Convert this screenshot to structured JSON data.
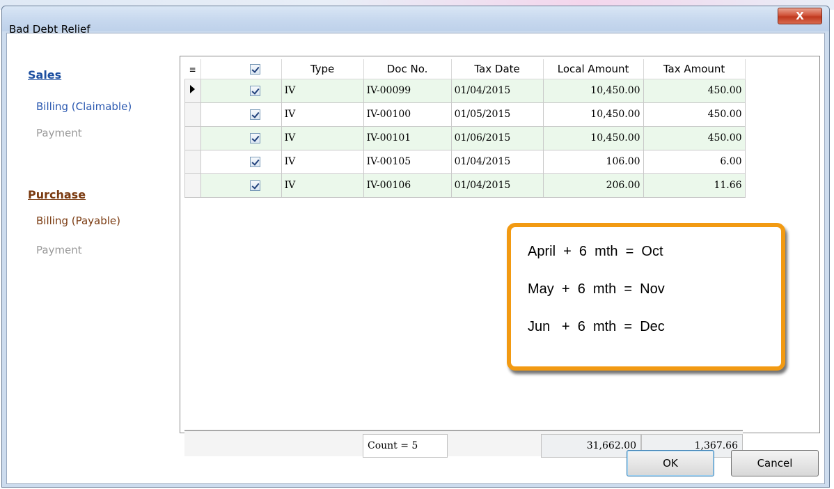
{
  "window": {
    "title": "Bad Debt Relief",
    "close_label": "X"
  },
  "sidebar": {
    "sales_heading": "Sales",
    "sales_items": [
      "Billing (Claimable)",
      "Payment"
    ],
    "purchase_heading": "Purchase",
    "purchase_items": [
      "Billing (Payable)",
      "Payment"
    ]
  },
  "grid": {
    "columns": [
      "Type",
      "Doc No.",
      "Tax Date",
      "Local Amount",
      "Tax Amount"
    ],
    "rows": [
      {
        "type": "IV",
        "doc_no": "IV-00099",
        "tax_date": "01/04/2015",
        "local_amount": "10,450.00",
        "tax_amount": "450.00"
      },
      {
        "type": "IV",
        "doc_no": "IV-00100",
        "tax_date": "01/05/2015",
        "local_amount": "10,450.00",
        "tax_amount": "450.00"
      },
      {
        "type": "IV",
        "doc_no": "IV-00101",
        "tax_date": "01/06/2015",
        "local_amount": "10,450.00",
        "tax_amount": "450.00"
      },
      {
        "type": "IV",
        "doc_no": "IV-00105",
        "tax_date": "01/04/2015",
        "local_amount": "106.00",
        "tax_amount": "6.00"
      },
      {
        "type": "IV",
        "doc_no": "IV-00106",
        "tax_date": "01/04/2015",
        "local_amount": "206.00",
        "tax_amount": "11.66"
      }
    ],
    "footer": {
      "count": "Count = 5",
      "local_total": "31,662.00",
      "tax_total": "1,367.66"
    }
  },
  "callout": {
    "lines": [
      "April  +  6  mth  =  Oct",
      "May  +  6  mth  =  Nov",
      "Jun   +  6  mth  =  Dec"
    ]
  },
  "buttons": {
    "ok": "OK",
    "cancel": "Cancel"
  }
}
